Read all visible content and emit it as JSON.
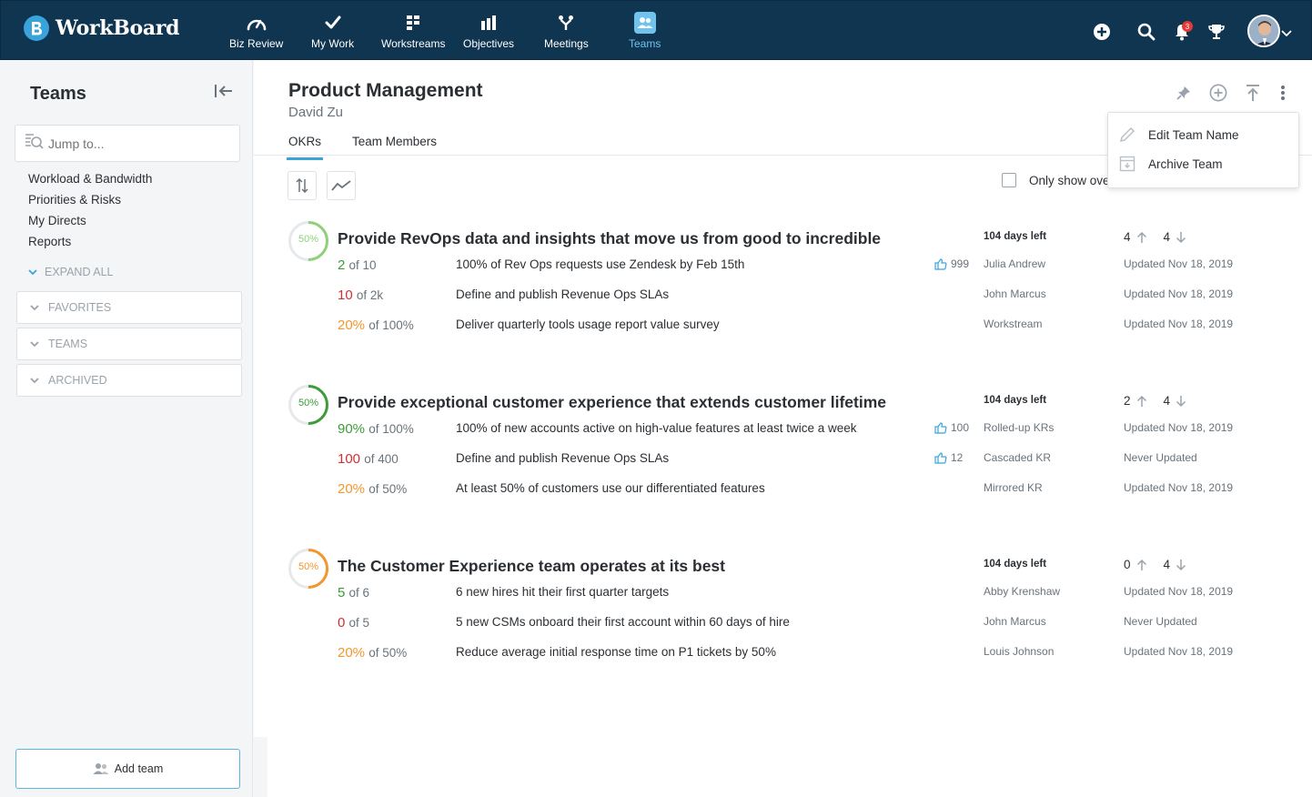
{
  "colors": {
    "green": "#3e9b3a",
    "lightgreen": "#8fd17a",
    "red": "#d32f2f",
    "orange": "#f2962d",
    "accent": "#3aa3d9",
    "navy": "#0f3550"
  },
  "app": {
    "name": "WorkBoard"
  },
  "nav": [
    {
      "label": "Biz Review",
      "icon": "gauge-icon"
    },
    {
      "label": "My Work",
      "icon": "check-icon"
    },
    {
      "label": "Workstreams",
      "icon": "grid-icon"
    },
    {
      "label": "Objectives",
      "icon": "bar-chart-icon"
    },
    {
      "label": "Meetings",
      "icon": "meetings-icon"
    },
    {
      "label": "Teams",
      "icon": "teams-icon",
      "active": true
    }
  ],
  "top_right": {
    "notification_count": "3"
  },
  "sidebar": {
    "title": "Teams",
    "search_placeholder": "Jump to...",
    "links": [
      "Workload & Bandwidth",
      "Priorities & Risks",
      "My Directs",
      "Reports"
    ],
    "expand_all": "EXPAND ALL",
    "sections": [
      "FAVORITES",
      "TEAMS",
      "ARCHIVED"
    ],
    "add_team": "Add team"
  },
  "header": {
    "title": "Product Management",
    "subtitle": "David Zu",
    "tabs": [
      "OKRs",
      "Team Members"
    ],
    "only_show": "Only show ove"
  },
  "menu": {
    "items": [
      {
        "label": "Edit Team Name",
        "icon": "pencil-icon"
      },
      {
        "label": "Archive Team",
        "icon": "archive-icon"
      }
    ]
  },
  "objectives": [
    {
      "progress_label": "50%",
      "progress": 0.5,
      "ring_color": "#8fd17a",
      "title": "Provide RevOps data and insights that move us from good to incredible",
      "days_left": "104 days left",
      "up": "4",
      "down": "4",
      "krs": [
        {
          "value": "2",
          "of": "of 10",
          "color": "#3e9b3a",
          "text": "100% of Rev Ops requests use Zendesk by Feb 15th",
          "likes": "999",
          "owner": "Julia Andrew",
          "updated": "Updated Nov 18, 2019"
        },
        {
          "value": "10",
          "of": "of 2k",
          "color": "#d32f2f",
          "text": "Define and publish Revenue Ops SLAs",
          "likes": "",
          "owner": "John Marcus",
          "updated": "Updated Nov 18, 2019"
        },
        {
          "value": "20%",
          "of": "of 100%",
          "color": "#f2962d",
          "text": "Deliver quarterly tools usage report value survey",
          "likes": "",
          "owner": "Workstream",
          "updated": "Updated Nov 18, 2019"
        }
      ]
    },
    {
      "progress_label": "50%",
      "progress": 0.5,
      "ring_color": "#3e9b3a",
      "title": "Provide exceptional customer experience that extends customer lifetime",
      "days_left": "104 days left",
      "up": "2",
      "down": "4",
      "krs": [
        {
          "value": "90%",
          "of": "of 100%",
          "color": "#3e9b3a",
          "text": "100% of new accounts active on high-value features at least twice a week",
          "likes": "100",
          "owner": "Rolled-up KRs",
          "updated": "Updated Nov 18, 2019"
        },
        {
          "value": "100",
          "of": "of 400",
          "color": "#d32f2f",
          "text": "Define and publish Revenue Ops SLAs",
          "likes": "12",
          "owner": "Cascaded KR",
          "updated": "Never Updated"
        },
        {
          "value": "20%",
          "of": "of 50%",
          "color": "#f2962d",
          "text": "At least 50% of customers use our differentiated features",
          "likes": "",
          "owner": "Mirrored KR",
          "updated": "Updated Nov 18, 2019"
        }
      ]
    },
    {
      "progress_label": "50%",
      "progress": 0.5,
      "ring_color": "#f2962d",
      "title": "The Customer Experience team operates at its best",
      "days_left": "104 days left",
      "up": "0",
      "down": "4",
      "krs": [
        {
          "value": "5",
          "of": "of 6",
          "color": "#3e9b3a",
          "text": "6 new hires hit their first quarter targets",
          "likes": "",
          "owner": "Abby Krenshaw",
          "updated": "Updated Nov 18, 2019"
        },
        {
          "value": "0",
          "of": "of 5",
          "color": "#d32f2f",
          "text": "5 new CSMs onboard their first account within 60 days of hire",
          "likes": "",
          "owner": "John Marcus",
          "updated": "Never Updated"
        },
        {
          "value": "20%",
          "of": "of 50%",
          "color": "#f2962d",
          "text": "Reduce average initial response time on P1 tickets by 50%",
          "likes": "",
          "owner": "Louis Johnson",
          "updated": "Updated Nov 18, 2019"
        }
      ]
    }
  ]
}
